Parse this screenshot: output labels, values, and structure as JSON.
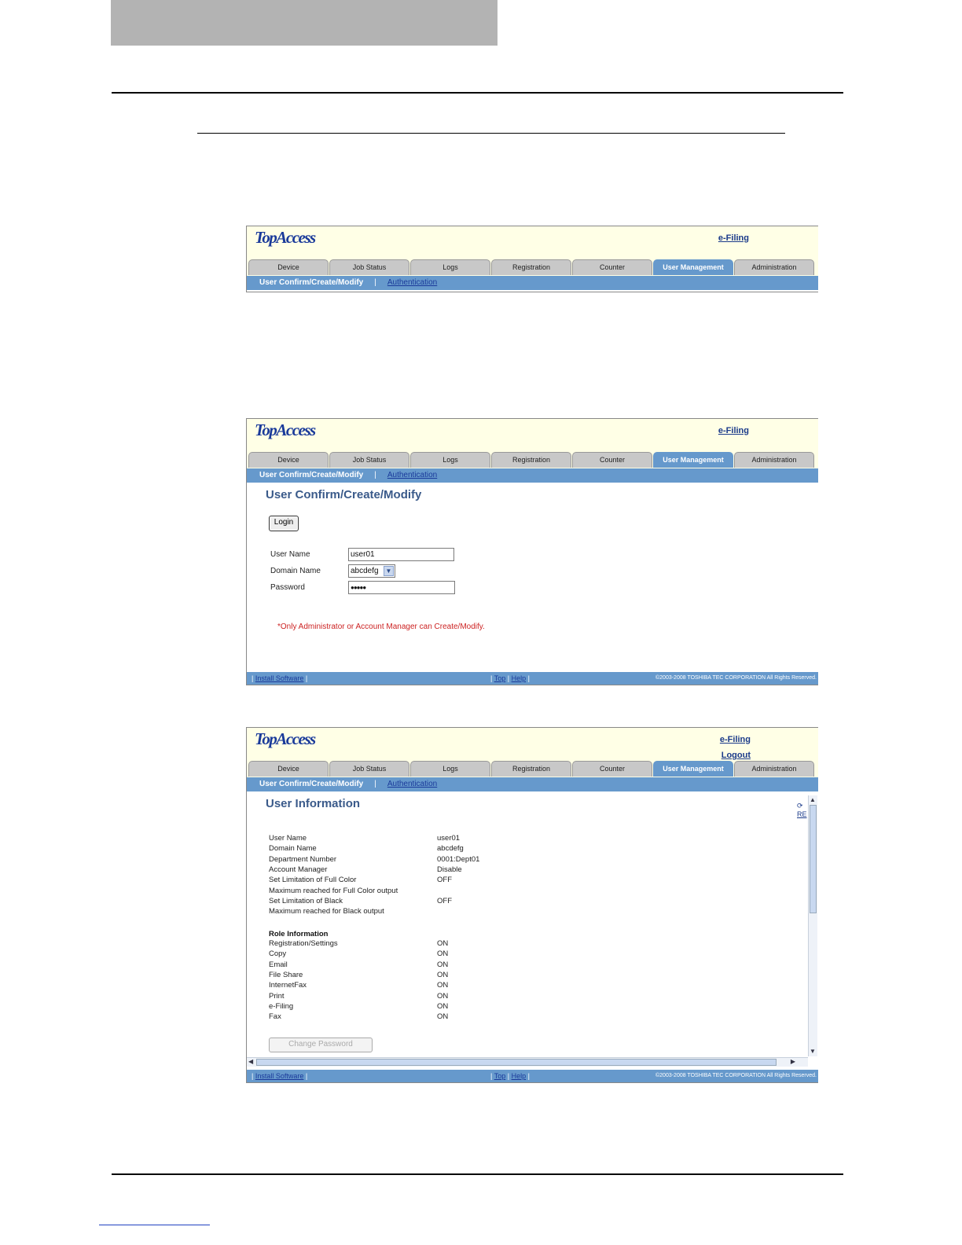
{
  "logo_text": "TopAccess",
  "links": {
    "efiling": "e-Filing",
    "logout": "Logout"
  },
  "tabs": [
    "Device",
    "Job Status",
    "Logs",
    "Registration",
    "Counter",
    "User Management",
    "Administration"
  ],
  "active_tab": "User Management",
  "subnav": {
    "current": "User Confirm/Create/Modify",
    "separator": "|",
    "link": "Authentication"
  },
  "login_screen": {
    "title": "User Confirm/Create/Modify",
    "login_button": "Login",
    "fields": {
      "user_name_label": "User Name",
      "user_name_value": "user01",
      "domain_label": "Domain Name",
      "domain_value": "abcdefg",
      "password_label": "Password",
      "password_value": "●●●●●"
    },
    "note": "*Only Administrator or Account Manager can Create/Modify."
  },
  "info_screen": {
    "title": "User Information",
    "refresh": "RE",
    "rows": [
      {
        "label": "User Name",
        "value": "user01"
      },
      {
        "label": "Domain Name",
        "value": "abcdefg"
      },
      {
        "label": "Department Number",
        "value": "0001:Dept01"
      },
      {
        "label": "Account Manager",
        "value": "Disable"
      },
      {
        "label": "Set Limitation of Full Color",
        "value": "OFF"
      },
      {
        "label": "Maximum reached for Full Color output",
        "value": ""
      },
      {
        "label": "Set Limitation of Black",
        "value": "OFF"
      },
      {
        "label": "Maximum reached for Black output",
        "value": ""
      }
    ],
    "role_header": "Role Information",
    "roles": [
      {
        "label": "Registration/Settings",
        "value": "ON"
      },
      {
        "label": "Copy",
        "value": "ON"
      },
      {
        "label": "Email",
        "value": "ON"
      },
      {
        "label": "File Share",
        "value": "ON"
      },
      {
        "label": "InternetFax",
        "value": "ON"
      },
      {
        "label": "Print",
        "value": "ON"
      },
      {
        "label": "e-Filing",
        "value": "ON"
      },
      {
        "label": "Fax",
        "value": "ON"
      }
    ],
    "change_password_button": "Change Password"
  },
  "footer": {
    "install_software": "Install Software",
    "top": "Top",
    "help": "Help",
    "pipe": "|",
    "copyright": "©2003-2008 TOSHIBA TEC CORPORATION All Rights Reserved."
  }
}
